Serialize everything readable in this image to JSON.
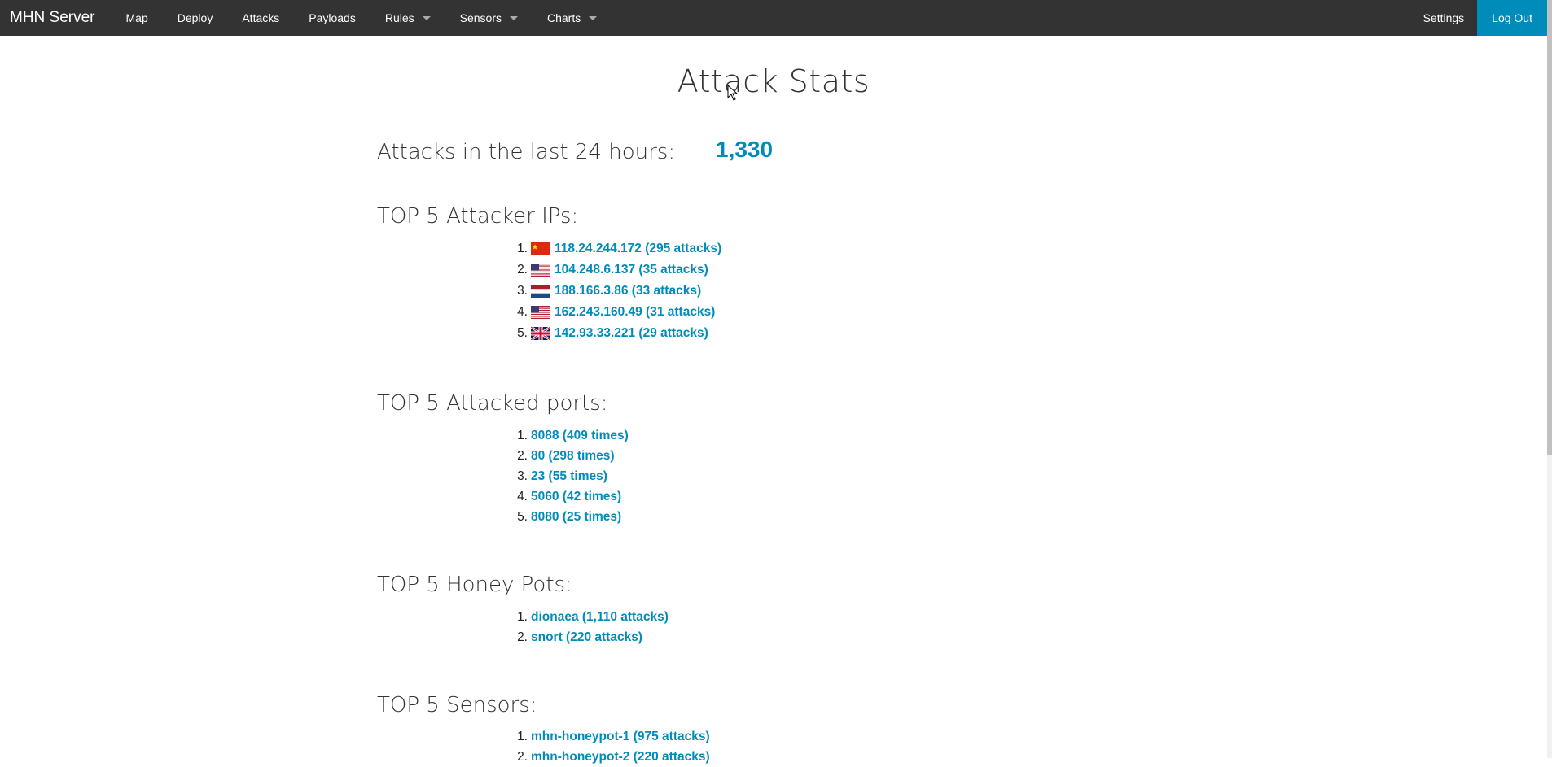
{
  "nav": {
    "brand": "MHN Server",
    "items": [
      {
        "label": "Map",
        "dropdown": false
      },
      {
        "label": "Deploy",
        "dropdown": false
      },
      {
        "label": "Attacks",
        "dropdown": false
      },
      {
        "label": "Payloads",
        "dropdown": false
      },
      {
        "label": "Rules",
        "dropdown": true
      },
      {
        "label": "Sensors",
        "dropdown": true
      },
      {
        "label": "Charts",
        "dropdown": true
      }
    ],
    "settings": "Settings",
    "logout": "Log Out"
  },
  "page": {
    "title": "Attack Stats",
    "last24_label": "Attacks in the last 24 hours:",
    "last24_value": "1,330"
  },
  "sections": {
    "ips": {
      "heading": "TOP 5 Attacker IPs:",
      "items": [
        {
          "num": "1.",
          "text": "118.24.244.172 (295 attacks)",
          "flag": "cn-flag-icon"
        },
        {
          "num": "2.",
          "text": "104.248.6.137 (35 attacks)",
          "flag": "us-flag-icon"
        },
        {
          "num": "3.",
          "text": "188.166.3.86 (33 attacks)",
          "flag": "nl-flag-icon"
        },
        {
          "num": "4.",
          "text": "162.243.160.49 (31 attacks)",
          "flag": "us-flag-icon"
        },
        {
          "num": "5.",
          "text": "142.93.33.221 (29 attacks)",
          "flag": "gb-flag-icon"
        }
      ]
    },
    "ports": {
      "heading": "TOP 5 Attacked ports:",
      "items": [
        {
          "num": "1.",
          "text": "8088 (409 times)"
        },
        {
          "num": "2.",
          "text": "80 (298 times)"
        },
        {
          "num": "3.",
          "text": "23 (55 times)"
        },
        {
          "num": "4.",
          "text": "5060 (42 times)"
        },
        {
          "num": "5.",
          "text": "8080 (25 times)"
        }
      ]
    },
    "honeypots": {
      "heading": "TOP 5 Honey Pots:",
      "items": [
        {
          "num": "1.",
          "text": "dionaea (1,110 attacks)"
        },
        {
          "num": "2.",
          "text": "snort (220 attacks)"
        }
      ]
    },
    "sensors": {
      "heading": "TOP 5 Sensors:",
      "items": [
        {
          "num": "1.",
          "text": "mhn-honeypot-1 (975 attacks)"
        },
        {
          "num": "2.",
          "text": "mhn-honeypot-2 (220 attacks)"
        }
      ]
    }
  },
  "colors": {
    "navbar": "#333333",
    "accent": "#008cba"
  }
}
